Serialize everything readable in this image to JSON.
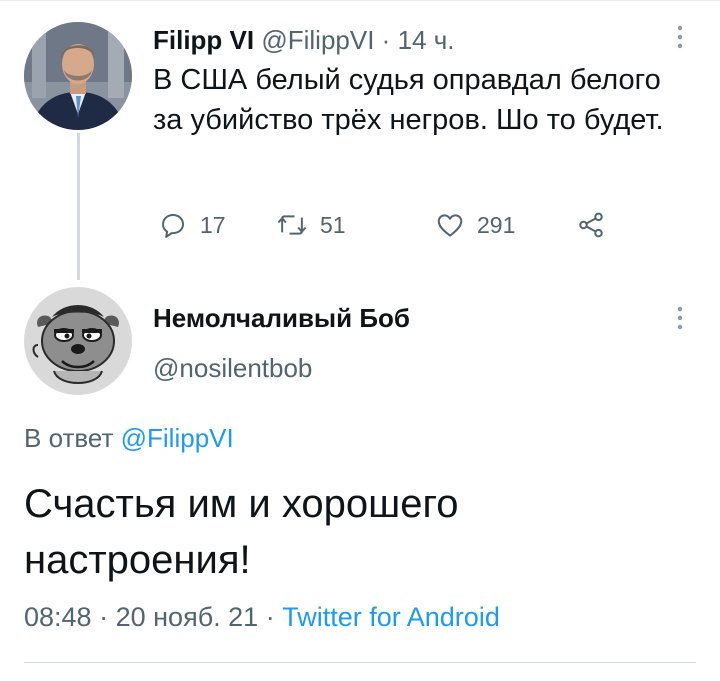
{
  "parent_tweet": {
    "author_name": "Filipp VI",
    "author_handle": "@FilippVI",
    "separator": "·",
    "time_ago": "14 ч.",
    "text": "В США белый судья оправдал белого за убийство трёх негров. Шо то будет.",
    "replies": "17",
    "retweets": "51",
    "likes": "291"
  },
  "reply_tweet": {
    "author_name": "Немолчаливый Боб",
    "author_handle": "@nosilentbob",
    "reply_prefix": "В ответ",
    "reply_to_handle": "@FilippVI",
    "text": "Счастья им и хорошего настроения!",
    "time": "08:48",
    "date": "20 нояб. 21",
    "separator": "·",
    "source": "Twitter for Android"
  },
  "icons": {
    "reply": "speech-bubble-icon",
    "retweet": "retweet-arrows-icon",
    "like": "heart-icon",
    "share": "share-nodes-icon",
    "more": "vertical-dots-icon"
  },
  "colors": {
    "link": "#1d9bf0",
    "muted": "#536471",
    "text": "#0f1419",
    "thread_line": "#cfd9de"
  }
}
